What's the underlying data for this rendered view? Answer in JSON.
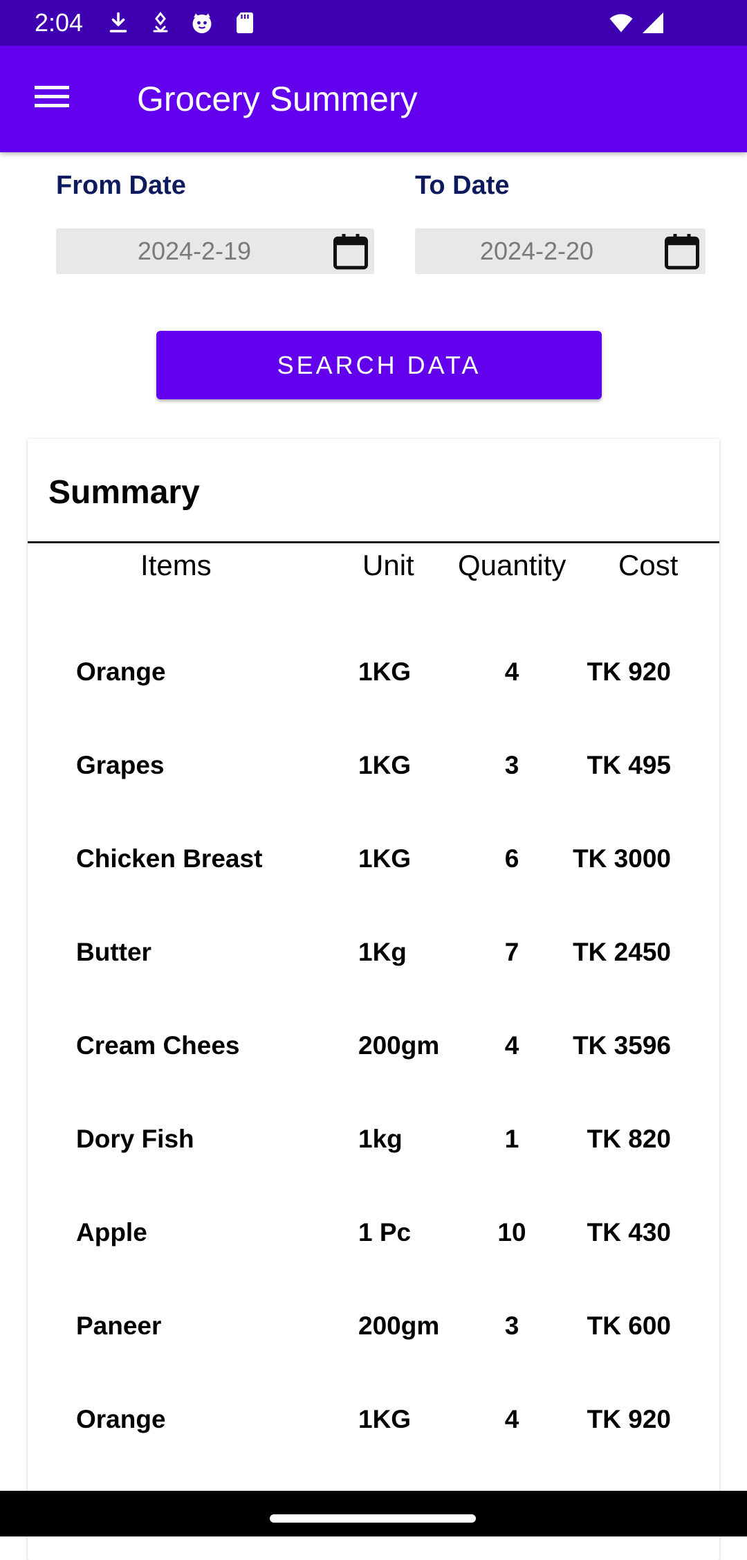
{
  "status_bar": {
    "time": "2:04",
    "icons": [
      "download-icon",
      "location-icon",
      "cat-face-icon",
      "sd-card-icon",
      "wifi-icon",
      "cellular-signal-icon"
    ]
  },
  "app_bar": {
    "title": "Grocery Summery",
    "menu_icon": "hamburger-menu-icon"
  },
  "from_date": {
    "label": "From Date",
    "value": "2024-2-19",
    "icon": "calendar-icon"
  },
  "to_date": {
    "label": "To Date",
    "value": "2024-2-20",
    "icon": "calendar-icon"
  },
  "search_button": {
    "label": "SEARCH DATA"
  },
  "summary": {
    "title": "Summary",
    "headers": {
      "items": "Items",
      "unit": "Unit",
      "quantity": "Quantity",
      "cost": "Cost"
    },
    "rows": [
      {
        "item": "Orange",
        "unit": "1KG",
        "quantity": "4",
        "cost": "TK 920"
      },
      {
        "item": "Grapes",
        "unit": "1KG",
        "quantity": "3",
        "cost": "TK 495"
      },
      {
        "item": "Chicken Breast",
        "unit": "1KG",
        "quantity": "6",
        "cost": "TK 3000"
      },
      {
        "item": "Butter",
        "unit": "1Kg",
        "quantity": "7",
        "cost": "TK 2450"
      },
      {
        "item": "Cream Chees",
        "unit": "200gm",
        "quantity": "4",
        "cost": "TK 3596"
      },
      {
        "item": "Dory Fish",
        "unit": "1kg",
        "quantity": "1",
        "cost": "TK 820"
      },
      {
        "item": "Apple",
        "unit": "1 Pc",
        "quantity": "10",
        "cost": "TK 430"
      },
      {
        "item": "Paneer",
        "unit": "200gm",
        "quantity": "3",
        "cost": "TK 600"
      },
      {
        "item": "Orange",
        "unit": "1KG",
        "quantity": "4",
        "cost": "TK 920"
      }
    ]
  },
  "colors": {
    "status_bar": "#3f00b2",
    "primary": "#6200ee",
    "label_text": "#0d1b5e",
    "field_background": "#e8e8e8"
  }
}
